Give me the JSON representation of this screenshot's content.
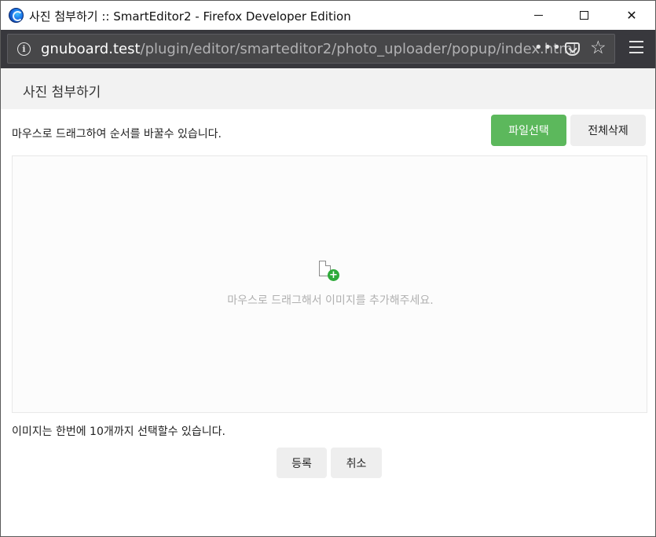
{
  "window": {
    "title": "사진 첨부하기 :: SmartEditor2 - Firefox Developer Edition",
    "controls": {
      "minimize": "—",
      "maximize": "☐",
      "close": "✕"
    }
  },
  "addressbar": {
    "url_host": "gnuboard.test",
    "url_path": "/plugin/editor/smarteditor2/photo_uploader/popup/index.html",
    "icons": [
      "info-icon",
      "more-icon",
      "pocket-icon",
      "bookmark-star-icon",
      "hamburger-menu-icon"
    ],
    "more_label": "•••",
    "star_label": "☆"
  },
  "popup": {
    "title": "사진 첨부하기",
    "hint": "마우스로 드래그하여 순서를 바꿀수 있습니다.",
    "select_files": "파일선택",
    "delete_all": "전체삭제",
    "dropzone_text": "마우스로 드래그해서 이미지를 추가해주세요.",
    "limit_text": "이미지는 한번에 10개까지 선택할수 있습니다.",
    "submit": "등록",
    "cancel": "취소"
  },
  "colors": {
    "primary_button": "#5cb85c",
    "add_icon": "#2eaa3a",
    "toolbar": "#38383d"
  }
}
